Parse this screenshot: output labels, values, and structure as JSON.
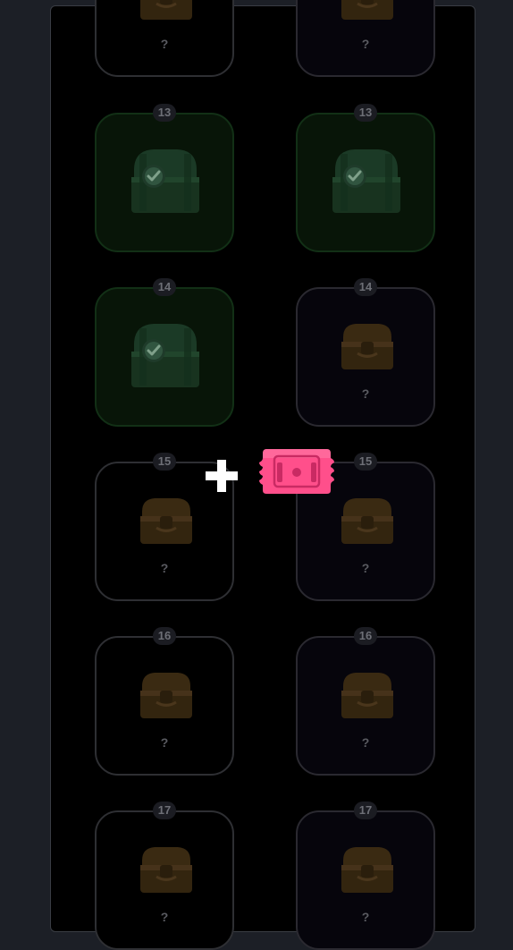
{
  "reward_grid": [
    {
      "tier": "",
      "left": {
        "label": "?",
        "status": "locked",
        "icon": "treasure-chest-icon"
      },
      "right": {
        "label": "?",
        "status": "locked",
        "icon": "treasure-chest-icon"
      }
    },
    {
      "tier": "13",
      "left": {
        "label": "",
        "status": "claimed",
        "icon": "claimed-chest-icon"
      },
      "right": {
        "label": "",
        "status": "claimed",
        "icon": "claimed-chest-icon"
      }
    },
    {
      "tier": "14",
      "left": {
        "label": "",
        "status": "claimed",
        "icon": "claimed-chest-icon"
      },
      "right": {
        "label": "?",
        "status": "locked",
        "icon": "treasure-chest-icon"
      }
    },
    {
      "tier": "15",
      "left": {
        "label": "?",
        "status": "locked",
        "icon": "treasure-chest-icon"
      },
      "right": {
        "label": "?",
        "status": "locked",
        "icon": "treasure-chest-icon"
      }
    },
    {
      "tier": "16",
      "left": {
        "label": "?",
        "status": "locked",
        "icon": "treasure-chest-icon"
      },
      "right": {
        "label": "?",
        "status": "locked",
        "icon": "treasure-chest-icon"
      }
    },
    {
      "tier": "17",
      "left": {
        "label": "?",
        "status": "locked",
        "icon": "treasure-chest-icon"
      },
      "right": {
        "label": "?",
        "status": "locked",
        "icon": "treasure-chest-icon"
      }
    }
  ],
  "overlay": {
    "plus_icon": "plus-icon",
    "ticket_icon": "ticket-icon",
    "ticket_color": "#ff4f8b"
  },
  "colors": {
    "locked_chest": "#3a2a12",
    "claimed_chest": "#1b3a26",
    "claimed_tile_bg": "#081508"
  }
}
